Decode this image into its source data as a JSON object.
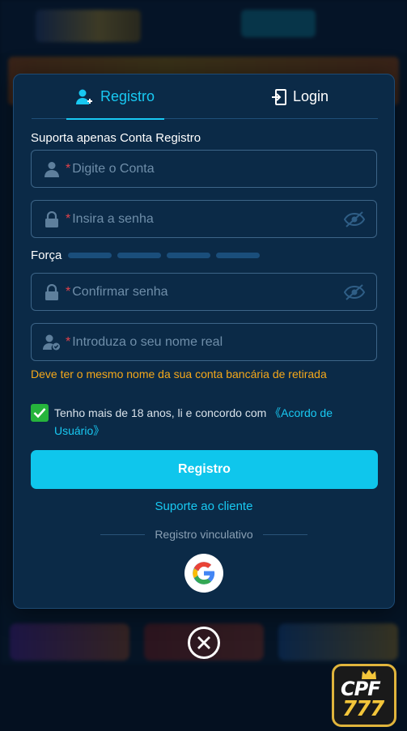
{
  "tabs": {
    "register": {
      "label": "Registro",
      "icon": "user-add-icon"
    },
    "login": {
      "label": "Login",
      "icon": "login-door-icon"
    }
  },
  "support_note": "Suporta apenas Conta Registro",
  "fields": {
    "account": {
      "required_mark": "*",
      "placeholder": "Digite o Conta",
      "icon": "user-icon"
    },
    "password": {
      "required_mark": "*",
      "placeholder": "Insira a senha",
      "icon": "lock-icon",
      "toggle_icon": "eye-off-icon"
    },
    "confirm": {
      "required_mark": "*",
      "placeholder": "Confirmar senha",
      "icon": "lock-icon",
      "toggle_icon": "eye-off-icon"
    },
    "realname": {
      "required_mark": "*",
      "placeholder": "Introduza o seu nome real",
      "icon": "user-check-icon"
    }
  },
  "strength": {
    "label": "Força",
    "levels": 4,
    "filled": 0
  },
  "realname_hint": "Deve ter o mesmo nome da sua conta bancária de retirada",
  "terms": {
    "checked": true,
    "text": "Tenho mais de 18 anos, li e concordo com ",
    "link": "《Acordo de Usuário》"
  },
  "submit_label": "Registro",
  "support_link": "Suporte ao cliente",
  "divider_text": "Registro vinculativo",
  "social": {
    "icon": "google-icon"
  },
  "close": {
    "icon": "close-icon"
  },
  "brand": {
    "line1": "CPF",
    "line2": "777",
    "icon": "crown-icon"
  },
  "colors": {
    "accent": "#18c9f2",
    "button": "#0fc6ec",
    "warning": "#f5a81a",
    "required": "#e0414a",
    "checkbox": "#26b43c",
    "modal_bg": "#0b2a47"
  }
}
